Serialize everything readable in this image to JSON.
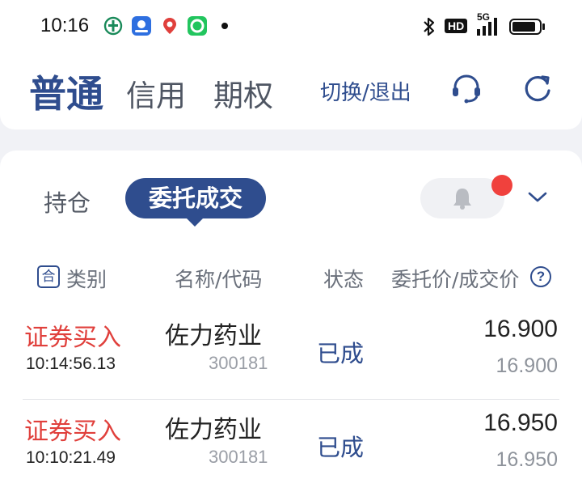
{
  "status_bar": {
    "time": "10:16",
    "hd_badge": "HD",
    "network": "5G",
    "icons": [
      "bank-app-icon",
      "baidu-map-icon",
      "maps-pin-app-icon",
      "green-app-icon",
      "bluetooth-icon",
      "signal-icon",
      "battery-icon"
    ]
  },
  "header": {
    "tabs": [
      {
        "label": "普通",
        "active": true
      },
      {
        "label": "信用",
        "active": false
      },
      {
        "label": "期权",
        "active": false
      }
    ],
    "switch_logout": "切换/退出",
    "icons": [
      "headset-icon",
      "refresh-icon"
    ]
  },
  "segments": {
    "holdings": "持仓",
    "orders": "委托成交"
  },
  "columns": {
    "category_badge": "合",
    "category": "类别",
    "name_code": "名称/代码",
    "status": "状态",
    "price": "委托价/成交价"
  },
  "orders": [
    {
      "type": "证券买入",
      "time": "10:14:56.13",
      "name": "佐力药业",
      "code": "300181",
      "status": "已成",
      "order_price": "16.900",
      "deal_price": "16.900"
    },
    {
      "type": "证券买入",
      "time": "10:10:21.49",
      "name": "佐力药业",
      "code": "300181",
      "status": "已成",
      "order_price": "16.950",
      "deal_price": "16.950"
    }
  ],
  "colors": {
    "brand_blue": "#2f4d8e",
    "buy_red": "#e0403c",
    "notification_red": "#f0413d"
  }
}
